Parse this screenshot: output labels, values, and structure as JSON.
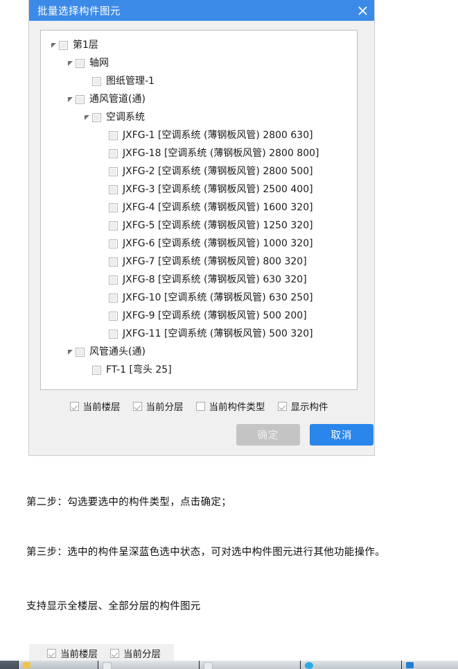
{
  "dialog": {
    "title": "批量选择构件图元",
    "close_icon": "close-icon",
    "tree": [
      {
        "level": 0,
        "expanded": true,
        "checked": false,
        "label": "第1层"
      },
      {
        "level": 1,
        "expanded": true,
        "checked": false,
        "label": "轴网"
      },
      {
        "level": 2,
        "expanded": null,
        "checked": false,
        "label": "图纸管理-1"
      },
      {
        "level": 1,
        "expanded": true,
        "checked": false,
        "label": "通风管道(通)"
      },
      {
        "level": 2,
        "expanded": true,
        "checked": false,
        "label": "空调系统"
      },
      {
        "level": 3,
        "expanded": null,
        "checked": false,
        "label": "JXFG-1 [空调系统 (薄钢板风管) 2800 630]"
      },
      {
        "level": 3,
        "expanded": null,
        "checked": false,
        "label": "JXFG-18 [空调系统 (薄钢板风管) 2800 800]"
      },
      {
        "level": 3,
        "expanded": null,
        "checked": false,
        "label": "JXFG-2 [空调系统 (薄钢板风管) 2800 500]"
      },
      {
        "level": 3,
        "expanded": null,
        "checked": false,
        "label": "JXFG-3 [空调系统 (薄钢板风管) 2500 400]"
      },
      {
        "level": 3,
        "expanded": null,
        "checked": false,
        "label": "JXFG-4 [空调系统 (薄钢板风管) 1600 320]"
      },
      {
        "level": 3,
        "expanded": null,
        "checked": false,
        "label": "JXFG-5 [空调系统 (薄钢板风管) 1250 320]"
      },
      {
        "level": 3,
        "expanded": null,
        "checked": false,
        "label": "JXFG-6 [空调系统 (薄钢板风管) 1000 320]"
      },
      {
        "level": 3,
        "expanded": null,
        "checked": false,
        "label": "JXFG-7 [空调系统 (薄钢板风管) 800 320]"
      },
      {
        "level": 3,
        "expanded": null,
        "checked": false,
        "label": "JXFG-8 [空调系统 (薄钢板风管) 630 320]"
      },
      {
        "level": 3,
        "expanded": null,
        "checked": false,
        "label": "JXFG-10 [空调系统 (薄钢板风管) 630 250]"
      },
      {
        "level": 3,
        "expanded": null,
        "checked": false,
        "label": "JXFG-9 [空调系统 (薄钢板风管) 500 200]"
      },
      {
        "level": 3,
        "expanded": null,
        "checked": false,
        "label": "JXFG-11 [空调系统 (薄钢板风管) 500 320]"
      },
      {
        "level": 1,
        "expanded": true,
        "checked": false,
        "label": "风管通头(通)"
      },
      {
        "level": 2,
        "expanded": null,
        "checked": false,
        "label": "FT-1 [弯头 25]"
      }
    ],
    "options": [
      {
        "label": "当前楼层",
        "checked": true
      },
      {
        "label": "当前分层",
        "checked": true
      },
      {
        "label": "当前构件类型",
        "checked": false
      },
      {
        "label": "显示构件",
        "checked": true
      }
    ],
    "buttons": {
      "ok": "确定",
      "cancel": "取消"
    }
  },
  "document": {
    "step2": "第二步：勾选要选中的构件类型，点击确定；",
    "step3": "第三步：选中的构件呈深蓝色选中状态，可对选中构件图元进行其他功能操作。",
    "support": "支持显示全楼层、全部分层的构件图元"
  },
  "cropped_panel": {
    "options": [
      {
        "label": "当前楼层",
        "checked": true
      },
      {
        "label": "当前分层",
        "checked": true
      }
    ]
  },
  "colors": {
    "titlebar_blue": "#3c8ae8",
    "cancel_blue": "#2a86eb",
    "ok_gray": "#c4c4c4",
    "dialog_bg": "#f0f0f0"
  }
}
